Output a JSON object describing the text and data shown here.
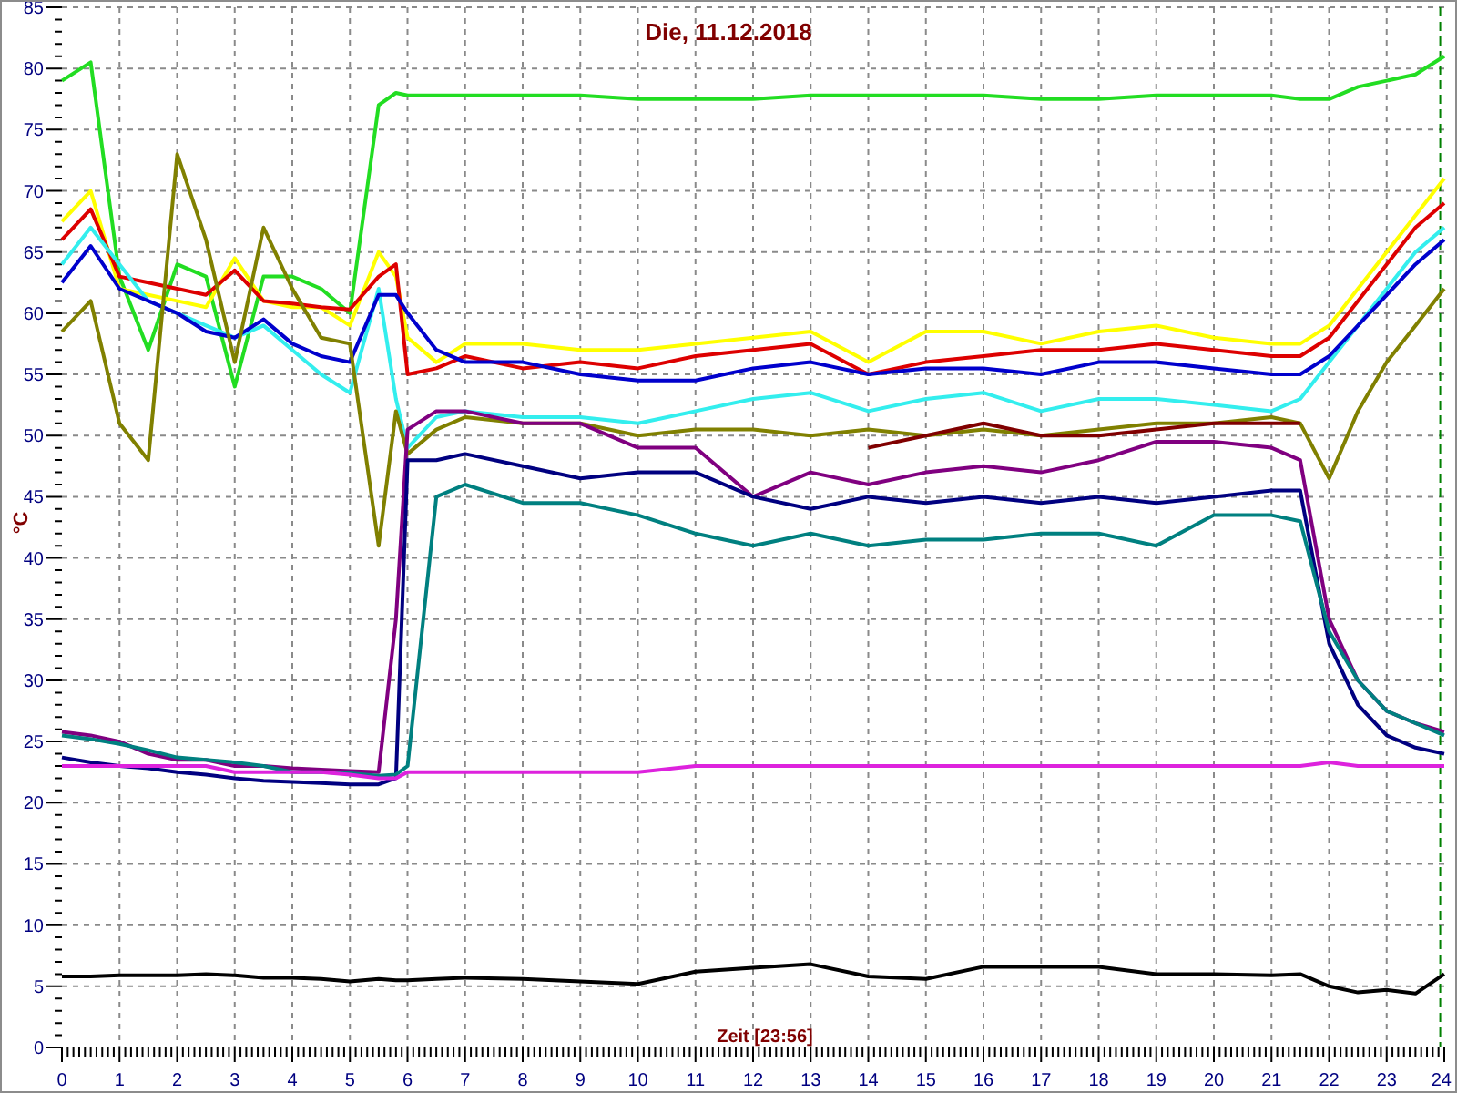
{
  "chart_data": {
    "type": "line",
    "title": "Die, 11.12.2018",
    "xlabel": "Zeit [23:56]",
    "ylabel": "°C",
    "x": [
      0,
      0.5,
      1,
      1.5,
      2,
      2.5,
      3,
      3.5,
      4,
      4.5,
      5,
      5.5,
      5.8,
      6,
      6.5,
      7,
      8,
      9,
      10,
      11,
      12,
      13,
      14,
      15,
      16,
      17,
      18,
      19,
      20,
      21,
      21.5,
      22,
      22.5,
      23,
      23.5,
      24
    ],
    "xlim": [
      0,
      24
    ],
    "ylim": [
      0,
      85
    ],
    "xticks": [
      0,
      1,
      2,
      3,
      4,
      5,
      6,
      7,
      8,
      9,
      10,
      11,
      12,
      13,
      14,
      15,
      16,
      17,
      18,
      19,
      20,
      21,
      22,
      23,
      24
    ],
    "yticks": [
      0,
      5,
      10,
      15,
      20,
      25,
      30,
      35,
      40,
      45,
      50,
      55,
      60,
      65,
      70,
      75,
      80,
      85
    ],
    "series": [
      {
        "color": "#22dd22",
        "values": [
          79,
          80.5,
          63,
          57,
          64,
          63,
          54,
          63,
          63,
          62,
          60,
          77,
          78,
          77.8,
          77.8,
          77.8,
          77.8,
          77.8,
          77.5,
          77.5,
          77.5,
          77.8,
          77.8,
          77.8,
          77.8,
          77.5,
          77.5,
          77.8,
          77.8,
          77.8,
          77.5,
          77.5,
          78.5,
          79,
          79.5,
          81
        ]
      },
      {
        "color": "#ffff00",
        "values": [
          67.5,
          70,
          62,
          61.5,
          61,
          60.5,
          64.5,
          61,
          60.5,
          60.5,
          59,
          65,
          63,
          58,
          56,
          57.5,
          57.5,
          57,
          57,
          57.5,
          58,
          58.5,
          56,
          58.5,
          58.5,
          57.5,
          58.5,
          59,
          58,
          57.5,
          57.5,
          59,
          62,
          65,
          68,
          71
        ]
      },
      {
        "color": "#dd0000",
        "values": [
          66,
          68.5,
          63,
          62.5,
          62,
          61.5,
          63.5,
          61,
          60.8,
          60.5,
          60.3,
          63,
          64,
          55,
          55.5,
          56.5,
          55.5,
          56,
          55.5,
          56.5,
          57,
          57.5,
          55,
          56,
          56.5,
          57,
          57,
          57.5,
          57,
          56.5,
          56.5,
          58,
          61,
          64,
          67,
          69
        ]
      },
      {
        "color": "#33eeee",
        "values": [
          64,
          67,
          64,
          61,
          60,
          59,
          58,
          59,
          57,
          55,
          53.5,
          62,
          53,
          49,
          51.5,
          52,
          51.5,
          51.5,
          51,
          52,
          53,
          53.5,
          52,
          53,
          53.5,
          52,
          53,
          53,
          52.5,
          52,
          53,
          56,
          59,
          62,
          65,
          67
        ]
      },
      {
        "color": "#0000cc",
        "values": [
          62.5,
          65.5,
          62,
          61,
          60,
          58.5,
          58,
          59.5,
          57.5,
          56.5,
          56,
          61.5,
          61.5,
          60,
          57,
          56,
          56,
          55,
          54.5,
          54.5,
          55.5,
          56,
          55,
          55.5,
          55.5,
          55,
          56,
          56,
          55.5,
          55,
          55,
          56.5,
          59,
          61.5,
          64,
          66
        ]
      },
      {
        "color": "#808000",
        "values": [
          58.5,
          61,
          51,
          48,
          73,
          66,
          56,
          67,
          62,
          58,
          57.5,
          41,
          52,
          48.5,
          50.5,
          51.5,
          51,
          51,
          50,
          50.5,
          50.5,
          50,
          50.5,
          50,
          50.5,
          50,
          50.5,
          51,
          51,
          51.5,
          51,
          46.5,
          52,
          56,
          59,
          62
        ]
      },
      {
        "color": "#800000",
        "values": [
          null,
          null,
          null,
          null,
          null,
          null,
          null,
          null,
          null,
          null,
          null,
          null,
          null,
          null,
          null,
          null,
          null,
          null,
          null,
          null,
          null,
          null,
          49,
          50,
          51,
          50,
          50,
          50.5,
          51,
          51,
          51,
          null,
          null,
          null,
          null,
          null
        ]
      },
      {
        "color": "#800080",
        "values": [
          25.8,
          25.5,
          25,
          24,
          23.5,
          23.5,
          23,
          23,
          22.8,
          22.7,
          22.6,
          22.5,
          35,
          50.5,
          52,
          52,
          51,
          51,
          49,
          49,
          45,
          47,
          46,
          47,
          47.5,
          47,
          48,
          49.5,
          49.5,
          49,
          48,
          35,
          30,
          27.5,
          26.5,
          25.8
        ]
      },
      {
        "color": "#000080",
        "values": [
          23.7,
          23.3,
          23,
          22.8,
          22.5,
          22.3,
          22,
          21.8,
          21.7,
          21.6,
          21.5,
          21.5,
          22,
          48,
          48,
          48.5,
          47.5,
          46.5,
          47,
          47,
          45,
          44,
          45,
          44.5,
          45,
          44.5,
          45,
          44.5,
          45,
          45.5,
          45.5,
          33,
          28,
          25.5,
          24.5,
          24
        ]
      },
      {
        "color": "#008080",
        "values": [
          25.5,
          25.2,
          24.8,
          24.3,
          23.7,
          23.5,
          23.3,
          23,
          22.5,
          22.5,
          22.4,
          22.2,
          22.3,
          23,
          45,
          46,
          44.5,
          44.5,
          43.5,
          42,
          41,
          42,
          41,
          41.5,
          41.5,
          42,
          42,
          41,
          43.5,
          43.5,
          43,
          34,
          30,
          27.5,
          26.5,
          25.5
        ]
      },
      {
        "color": "#dd22dd",
        "values": [
          23,
          23,
          23,
          23,
          23,
          23,
          22.5,
          22.5,
          22.5,
          22.5,
          22.3,
          22,
          22,
          22.5,
          22.5,
          22.5,
          22.5,
          22.5,
          22.5,
          23,
          23,
          23,
          23,
          23,
          23,
          23,
          23,
          23,
          23,
          23,
          23,
          23.3,
          23,
          23,
          23,
          23
        ]
      },
      {
        "color": "#000000",
        "values": [
          5.8,
          5.8,
          5.9,
          5.9,
          5.9,
          6,
          5.9,
          5.7,
          5.7,
          5.6,
          5.4,
          5.6,
          5.5,
          5.5,
          5.6,
          5.7,
          5.6,
          5.4,
          5.2,
          6.2,
          6.5,
          6.8,
          5.8,
          5.6,
          6.6,
          6.6,
          6.6,
          6,
          6,
          5.9,
          6,
          5,
          4.5,
          4.7,
          4.4,
          6
        ]
      }
    ],
    "grid": true,
    "ref_lines": [
      {
        "axis": "x",
        "value": 23.93
      }
    ]
  }
}
